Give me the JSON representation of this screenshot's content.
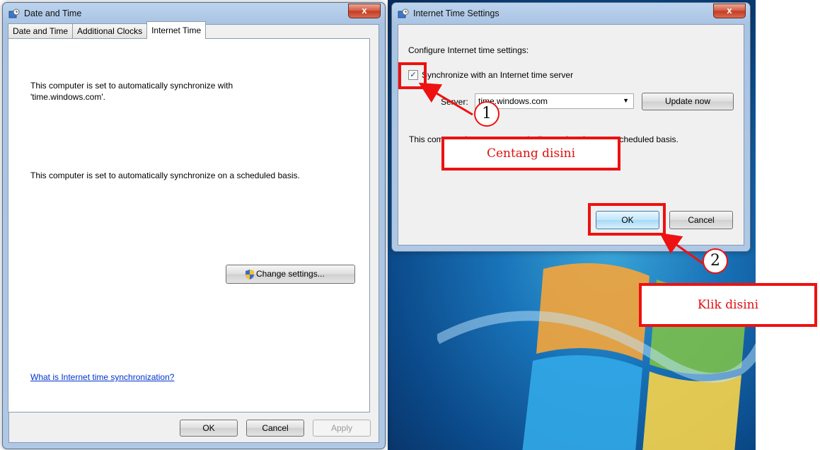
{
  "date_time_window": {
    "title": "Date and Time",
    "tabs": [
      "Date and Time",
      "Additional Clocks",
      "Internet Time"
    ],
    "active_tab": "Internet Time",
    "sync_line1": "This computer is set to automatically synchronize with",
    "sync_line2": "'time.windows.com'.",
    "schedule_text": "This computer is set to automatically synchronize on a scheduled basis.",
    "change_settings_label": "Change settings...",
    "help_link": "What is Internet time synchronization?",
    "ok_label": "OK",
    "cancel_label": "Cancel",
    "apply_label": "Apply",
    "close_glyph": "x"
  },
  "internet_time_dialog": {
    "title": "Internet Time Settings",
    "heading": "Configure Internet time settings:",
    "sync_checkbox_label": "Synchronize with an Internet time server",
    "sync_checked": true,
    "server_label": "Server:",
    "server_value": "time.windows.com",
    "update_now_label": "Update now",
    "status_text": "This computer is set to automatically synchronize on a scheduled basis.",
    "ok_label": "OK",
    "cancel_label": "Cancel",
    "close_glyph": "x"
  },
  "annotations": {
    "badge_1": "1",
    "callout_1": "Centang disini",
    "badge_2": "2",
    "callout_2": "Klik disini",
    "color": "#ee1111"
  },
  "icons": {
    "window_icon": "date-time-clock-icon",
    "shield_icon": "uac-shield-icon",
    "dropdown_icon": "chevron-down-icon",
    "close_icon": "close-icon"
  }
}
